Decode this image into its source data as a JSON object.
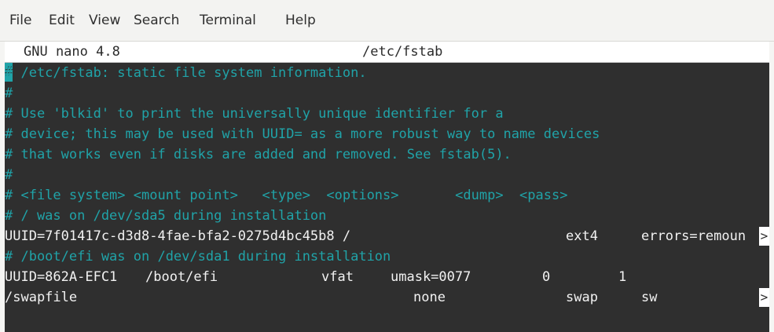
{
  "menu": {
    "file": "File",
    "edit": "Edit",
    "view": "View",
    "search": "Search",
    "terminal": "Terminal",
    "help": "Help"
  },
  "nano": {
    "version": "GNU nano 4.8",
    "filename": "/etc/fstab"
  },
  "lines": {
    "l1": "# /etc/fstab: static file system information.",
    "l2": "#",
    "l3": "# Use 'blkid' to print the universally unique identifier for a",
    "l4": "# device; this may be used with UUID= as a more robust way to name devices",
    "l5": "# that works even if disks are added and removed. See fstab(5).",
    "l6": "#",
    "l7": "# <file system> <mount point>   <type>  <options>       <dump>  <pass>",
    "l8": "# / was on /dev/sda5 during installation",
    "l9": {
      "uuid": "UUID=7f01417c-d3d8-4fae-bfa2-0275d4bc45b8 /",
      "type": "ext4",
      "options": "errors=remoun"
    },
    "l10": "# /boot/efi was on /dev/sda1 during installation",
    "l11": {
      "uuid": "UUID=862A-EFC1",
      "mount": "/boot/efi",
      "type": "vfat",
      "options": "umask=0077",
      "dump": "0",
      "pass": "1"
    },
    "l12": {
      "fs": "/swapfile",
      "mount": "none",
      "type": "swap",
      "options": "sw"
    },
    "overflow_marker": ">"
  },
  "colors": {
    "terminal_bg": "#2f2f2f",
    "comment": "#20a3a8",
    "text": "#f2f2f2",
    "header_bg": "#ffffff"
  }
}
